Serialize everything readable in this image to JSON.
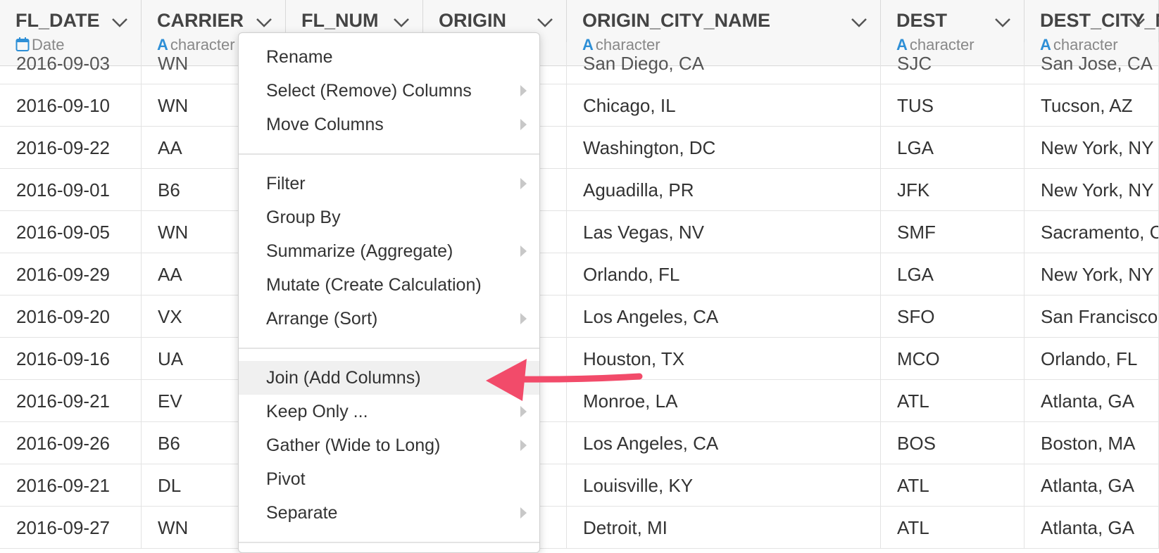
{
  "columns": [
    {
      "name": "FL_DATE",
      "type": "Date",
      "type_icon": "calendar-icon"
    },
    {
      "name": "CARRIER",
      "type": "character",
      "type_icon": "character-type-icon"
    },
    {
      "name": "FL_NUM",
      "type": "",
      "type_icon": ""
    },
    {
      "name": "ORIGIN",
      "type": "",
      "type_icon": ""
    },
    {
      "name": "ORIGIN_CITY_NAME",
      "type": "character",
      "type_icon": "character-type-icon"
    },
    {
      "name": "DEST",
      "type": "character",
      "type_icon": "character-type-icon"
    },
    {
      "name": "DEST_CITY_NAME",
      "type": "character",
      "type_icon": "character-type-icon"
    }
  ],
  "type_letter": "A",
  "partial_row": [
    "2016-09-03",
    "WN",
    "",
    "",
    "San Diego, CA",
    "SJC",
    "San Jose, CA"
  ],
  "rows": [
    [
      "2016-09-10",
      "WN",
      "Chicago, IL",
      "TUS",
      "Tucson, AZ"
    ],
    [
      "2016-09-22",
      "AA",
      "Washington, DC",
      "LGA",
      "New York, NY"
    ],
    [
      "2016-09-01",
      "B6",
      "Aguadilla, PR",
      "JFK",
      "New York, NY"
    ],
    [
      "2016-09-05",
      "WN",
      "Las Vegas, NV",
      "SMF",
      "Sacramento, CA"
    ],
    [
      "2016-09-29",
      "AA",
      "Orlando, FL",
      "LGA",
      "New York, NY"
    ],
    [
      "2016-09-20",
      "VX",
      "Los Angeles, CA",
      "SFO",
      "San Francisco, CA"
    ],
    [
      "2016-09-16",
      "UA",
      "Houston, TX",
      "MCO",
      "Orlando, FL"
    ],
    [
      "2016-09-21",
      "EV",
      "Monroe, LA",
      "ATL",
      "Atlanta, GA"
    ],
    [
      "2016-09-26",
      "B6",
      "Los Angeles, CA",
      "BOS",
      "Boston, MA"
    ],
    [
      "2016-09-21",
      "DL",
      "Louisville, KY",
      "ATL",
      "Atlanta, GA"
    ],
    [
      "2016-09-27",
      "WN",
      "Detroit, MI",
      "ATL",
      "Atlanta, GA"
    ]
  ],
  "menu": {
    "groups": [
      [
        {
          "label": "Rename",
          "submenu": false
        },
        {
          "label": "Select (Remove) Columns",
          "submenu": true
        },
        {
          "label": "Move Columns",
          "submenu": true
        }
      ],
      [
        {
          "label": "Filter",
          "submenu": true
        },
        {
          "label": "Group By",
          "submenu": false
        },
        {
          "label": "Summarize (Aggregate)",
          "submenu": true
        },
        {
          "label": "Mutate (Create Calculation)",
          "submenu": false
        },
        {
          "label": "Arrange (Sort)",
          "submenu": true
        }
      ],
      [
        {
          "label": "Join (Add Columns)",
          "submenu": false,
          "highlighted": true
        },
        {
          "label": "Keep Only ...",
          "submenu": true
        },
        {
          "label": "Gather (Wide to Long)",
          "submenu": true
        },
        {
          "label": "Pivot",
          "submenu": false
        },
        {
          "label": "Separate",
          "submenu": true
        }
      ]
    ]
  },
  "colors": {
    "accent_type_icon": "#2e8fd6",
    "annotation_arrow": "#f24b6a",
    "menu_highlight": "#f0f0f0"
  }
}
